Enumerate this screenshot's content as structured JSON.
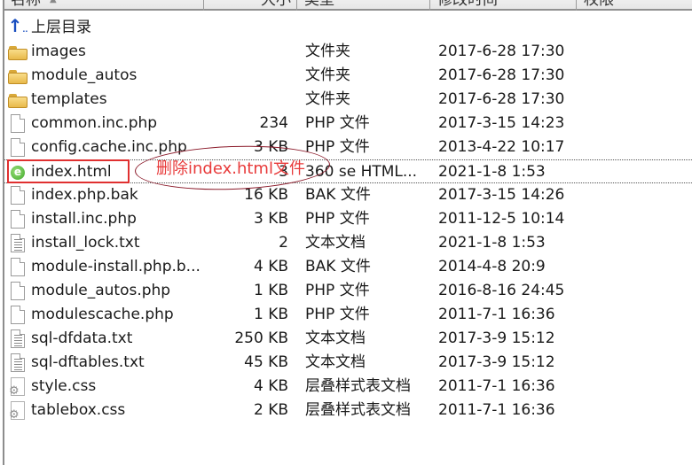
{
  "columns": {
    "name": "名称",
    "size": "大小",
    "type": "类型",
    "modified": "修改时间",
    "permissions": "权限"
  },
  "sort_indicator": "up-arrow",
  "files": [
    {
      "name": "上层目录",
      "size": "",
      "type": "",
      "modified": "",
      "icon": "parent-directory-icon"
    },
    {
      "name": "images",
      "size": "",
      "type": "文件夹",
      "modified": "2017-6-28 17:30",
      "icon": "folder-icon"
    },
    {
      "name": "module_autos",
      "size": "",
      "type": "文件夹",
      "modified": "2017-6-28 17:30",
      "icon": "folder-icon"
    },
    {
      "name": "templates",
      "size": "",
      "type": "文件夹",
      "modified": "2017-6-28 17:30",
      "icon": "folder-icon"
    },
    {
      "name": "common.inc.php",
      "size": "234",
      "type": "PHP 文件",
      "modified": "2017-3-15 14:23",
      "icon": "file-icon"
    },
    {
      "name": "config.cache.inc.php",
      "size": "3 KB",
      "type": "PHP 文件",
      "modified": "2013-4-22 10:17",
      "icon": "file-icon"
    },
    {
      "name": "index.html",
      "size": "3",
      "type": "360 se HTML...",
      "modified": "2021-1-8 1:53",
      "icon": "html-document-icon",
      "focused": true
    },
    {
      "name": "index.php.bak",
      "size": "16 KB",
      "type": "BAK 文件",
      "modified": "2017-3-15 14:26",
      "icon": "file-icon"
    },
    {
      "name": "install.inc.php",
      "size": "3 KB",
      "type": "PHP 文件",
      "modified": "2011-12-5 10:14",
      "icon": "file-icon"
    },
    {
      "name": "install_lock.txt",
      "size": "2",
      "type": "文本文档",
      "modified": "2021-1-8 1:53",
      "icon": "text-file-icon"
    },
    {
      "name": "module-install.php.b...",
      "size": "4 KB",
      "type": "BAK 文件",
      "modified": "2014-4-8 20:9",
      "icon": "file-icon"
    },
    {
      "name": "module_autos.php",
      "size": "1 KB",
      "type": "PHP 文件",
      "modified": "2016-8-16 24:45",
      "icon": "file-icon"
    },
    {
      "name": "modulescache.php",
      "size": "1 KB",
      "type": "PHP 文件",
      "modified": "2011-7-1 16:36",
      "icon": "file-icon"
    },
    {
      "name": "sql-dfdata.txt",
      "size": "250 KB",
      "type": "文本文档",
      "modified": "2017-3-9 15:12",
      "icon": "text-file-icon"
    },
    {
      "name": "sql-dftables.txt",
      "size": "45 KB",
      "type": "文本文档",
      "modified": "2017-3-9 15:12",
      "icon": "text-file-icon"
    },
    {
      "name": "style.css",
      "size": "4 KB",
      "type": "层叠样式表文档",
      "modified": "2011-7-1 16:36",
      "icon": "css-file-icon"
    },
    {
      "name": "tablebox.css",
      "size": "2 KB",
      "type": "层叠样式表文档",
      "modified": "2011-7-1 16:36",
      "icon": "css-file-icon"
    }
  ],
  "annotation": {
    "text": "删除index.html文件",
    "color": "#e83a3a",
    "target": "index.html"
  },
  "colors": {
    "annotation_red": "#e03030",
    "ellipse": "#8b1a2a",
    "folder": "#e8b94a",
    "parent_arrow": "#1a4fc0",
    "html_icon": "#3fa82a"
  }
}
